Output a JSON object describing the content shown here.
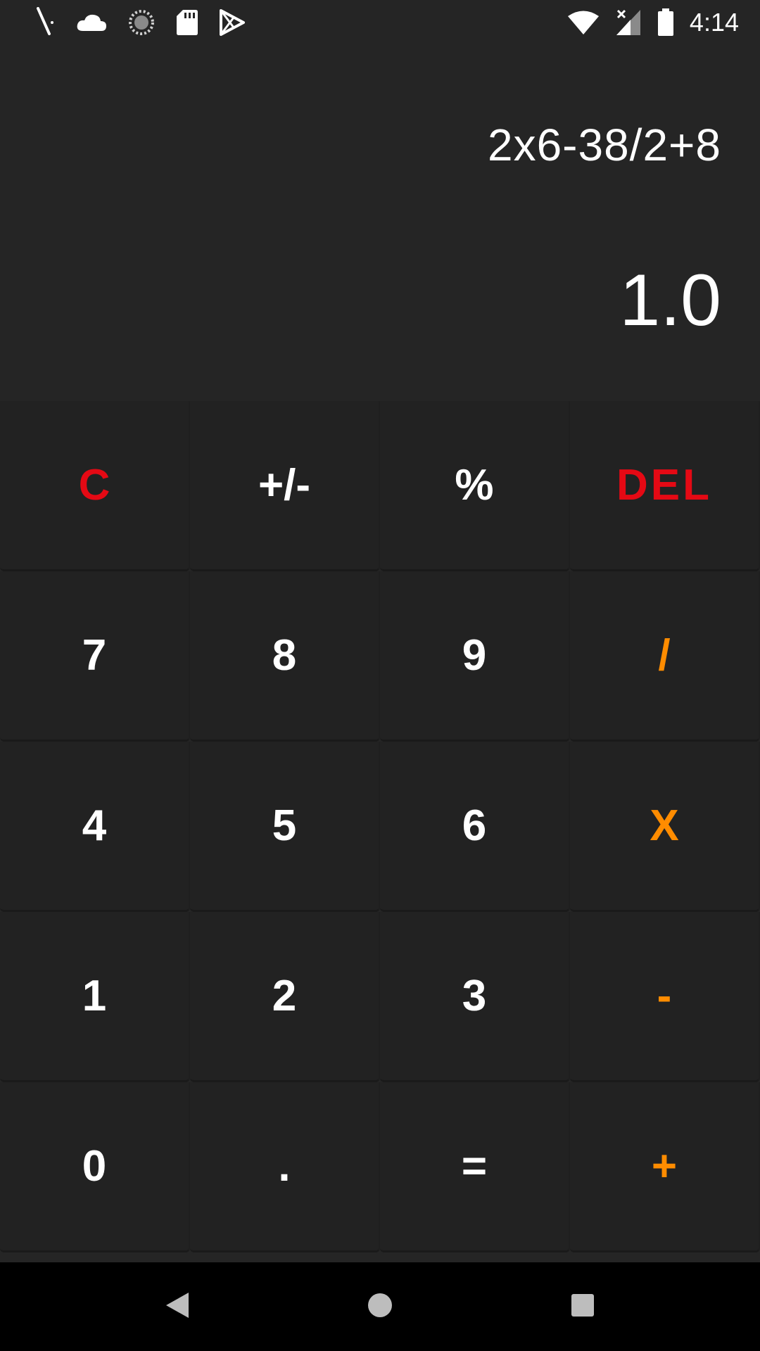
{
  "status_bar": {
    "time": "4:14",
    "left_icons": [
      "pen-icon",
      "cloud-icon",
      "sync-circle-icon",
      "sd-card-icon",
      "play-store-icon"
    ],
    "right_icons": [
      "wifi-icon",
      "cell-signal-icon",
      "battery-icon"
    ]
  },
  "display": {
    "expression": "2x6-38/2+8",
    "result": "1.0"
  },
  "keypad": {
    "rows": [
      [
        {
          "label": "C",
          "color": "#e50914"
        },
        {
          "label": "+/-"
        },
        {
          "label": "%"
        },
        {
          "label": "DEL",
          "color": "#e50914"
        }
      ],
      [
        {
          "label": "7"
        },
        {
          "label": "8"
        },
        {
          "label": "9"
        },
        {
          "label": "/",
          "color": "#ff8c00"
        }
      ],
      [
        {
          "label": "4"
        },
        {
          "label": "5"
        },
        {
          "label": "6"
        },
        {
          "label": "X",
          "color": "#ff8c00"
        }
      ],
      [
        {
          "label": "1"
        },
        {
          "label": "2"
        },
        {
          "label": "3"
        },
        {
          "label": "-",
          "color": "#ff8c00"
        }
      ],
      [
        {
          "label": "0"
        },
        {
          "label": "."
        },
        {
          "label": "="
        },
        {
          "label": "+",
          "color": "#ff8c00"
        }
      ]
    ]
  },
  "nav_bar": {
    "buttons": [
      "back-icon",
      "home-icon",
      "recents-icon"
    ]
  },
  "colors": {
    "background": "#252525",
    "key_background": "#222222",
    "accent_red": "#e50914",
    "accent_orange": "#ff8c00"
  }
}
